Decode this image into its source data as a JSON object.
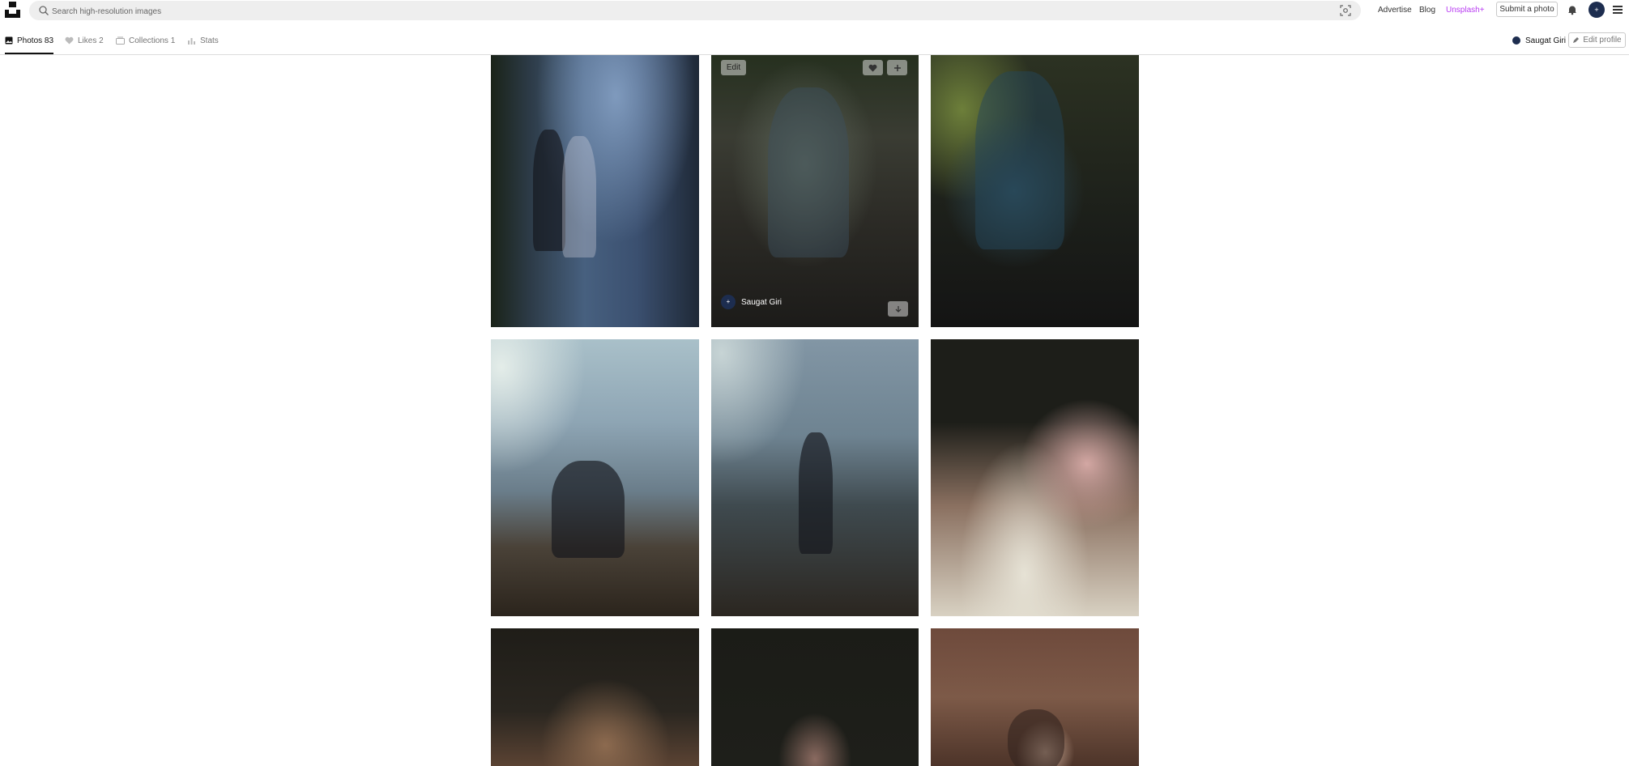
{
  "header": {
    "search_placeholder": "Search high-resolution images",
    "links": {
      "advertise": "Advertise",
      "blog": "Blog",
      "unsplash_plus": "Unsplash+"
    },
    "submit_label": "Submit a photo",
    "avatar_initial": "+"
  },
  "tabs": {
    "photos": "Photos 83",
    "likes": "Likes 2",
    "collections": "Collections 1",
    "stats": "Stats"
  },
  "profile": {
    "user_name": "Saugat Giri",
    "edit_label": "Edit profile"
  },
  "hovered_photo": {
    "edit_label": "Edit",
    "author_name": "Saugat Giri",
    "avatar_initial": "+"
  },
  "colors": {
    "accent_plus": "#b83af2",
    "avatar_bg": "#1d2d4f"
  }
}
